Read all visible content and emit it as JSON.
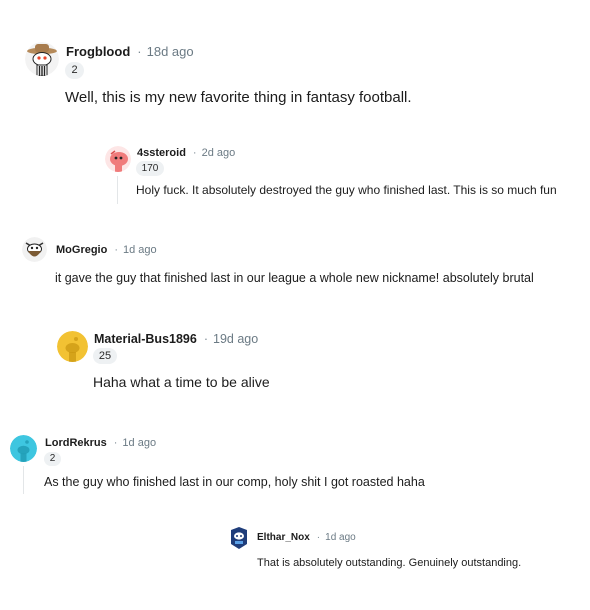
{
  "comments": [
    {
      "user": "Frogblood",
      "time": "18d ago",
      "score": "2",
      "text": "Well, this is my new favorite thing in fantasy football.",
      "avatar_icon": "cowboy-snoo-avatar-icon"
    },
    {
      "user": "4ssteroid",
      "time": "2d ago",
      "score": "170",
      "text": "Holy fuck. It absolutely destroyed the guy who finished last. This is so much fun",
      "avatar_icon": "pink-snoo-avatar-icon"
    },
    {
      "user": "MoGregio",
      "time": "1d ago",
      "text": "it gave the guy that finished last in our league a whole new nickname! absolutely brutal",
      "avatar_icon": "bearded-snoo-avatar-icon"
    },
    {
      "user": "Material-Bus1896",
      "time": "19d ago",
      "score": "25",
      "text": "Haha what a time to be alive",
      "avatar_icon": "yellow-default-avatar-icon"
    },
    {
      "user": "LordRekrus",
      "time": "1d ago",
      "score": "2",
      "text": "As the guy who finished last in our comp, holy shit I got roasted haha",
      "avatar_icon": "cyan-default-avatar-icon"
    },
    {
      "user": "Elthar_Nox",
      "time": "1d ago",
      "text": "That is absolutely outstanding. Genuinely outstanding.",
      "avatar_icon": "blue-snoo-avatar-icon"
    }
  ],
  "separator": "·",
  "colors": {
    "meta_gray": "#6b7a84",
    "score_bg": "#eef1f3",
    "thread_line": "#e3e6e8",
    "yellow_avatar": "#f2c233",
    "cyan_avatar": "#3ec6e0"
  }
}
